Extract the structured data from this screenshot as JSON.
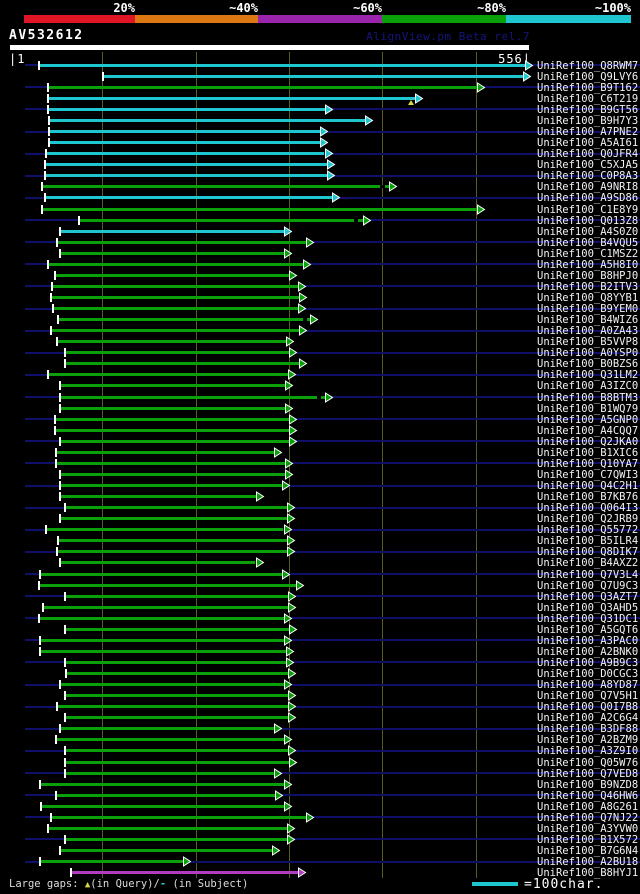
{
  "title": {
    "query_id": "AV532612",
    "watermark": "AlignView.pm Beta rel.7"
  },
  "ruler": {
    "start": "|1",
    "end": "556|"
  },
  "colors": {
    "red": "#de1626",
    "orange": "#dd7712",
    "purple": "#9b24ad",
    "green": "#0aa00a",
    "cyan": "#1ec7cf",
    "magenta": "#b13cc1",
    "navy": "#10106a",
    "grid": "#5c5c22",
    "white": "#ffffff",
    "watermark_text": "#15157d",
    "legend_text": "#dcdcdc",
    "gap_yellow": "#d6d64a"
  },
  "legend": {
    "large_gaps_prefix": "Large gaps: ",
    "query_gap_glyph": "▲",
    "query_gap_text": "(in Query)/",
    "subject_gap_glyph": "-",
    "subject_gap_text": " (in Subject)",
    "scale_bar_text": "=100char."
  },
  "chart_data": {
    "type": "bar",
    "orientation": "horizontal",
    "title": "AV532612 — graphical overview of database hits",
    "query_id": "AV532612",
    "query_length": 556,
    "x_axis": {
      "min": 1,
      "max": 556,
      "ticks": [
        100,
        200,
        300,
        400,
        500
      ]
    },
    "identity_scale": [
      {
        "label": "20%",
        "color_key": "red"
      },
      {
        "label": "~40%",
        "color_key": "orange"
      },
      {
        "label": "~60%",
        "color_key": "purple"
      },
      {
        "label": "~80%",
        "color_key": "green"
      },
      {
        "label": "~100%",
        "color_key": "cyan"
      }
    ],
    "hits": [
      {
        "id": "UniRef100_Q8RWM7",
        "color": "cyan",
        "q_start": 32,
        "q_end": 553
      },
      {
        "id": "UniRef100_Q9LVY6",
        "color": "cyan",
        "q_start": 101,
        "q_end": 551
      },
      {
        "id": "UniRef100_B9T162",
        "color": "green",
        "q_start": 42,
        "q_end": 501
      },
      {
        "id": "UniRef100_C6T219",
        "color": "cyan",
        "q_start": 42,
        "q_end": 435,
        "gap_query": 431
      },
      {
        "id": "UniRef100_B9GT56",
        "color": "cyan",
        "q_start": 42,
        "q_end": 338
      },
      {
        "id": "UniRef100_B9H7Y3",
        "color": "cyan",
        "q_start": 43,
        "q_end": 381
      },
      {
        "id": "UniRef100_A7PNE2",
        "color": "cyan",
        "q_start": 43,
        "q_end": 333
      },
      {
        "id": "UniRef100_A5AI61",
        "color": "cyan",
        "q_start": 43,
        "q_end": 333
      },
      {
        "id": "UniRef100_Q0JFR4",
        "color": "cyan",
        "q_start": 40,
        "q_end": 338
      },
      {
        "id": "UniRef100_C5XJA5",
        "color": "cyan",
        "q_start": 38,
        "q_end": 341
      },
      {
        "id": "UniRef100_C0P8A3",
        "color": "cyan",
        "q_start": 38,
        "q_end": 341
      },
      {
        "id": "UniRef100_A9NRI8",
        "color": "green",
        "q_start": 35,
        "q_end": 407,
        "gap_subject": 398
      },
      {
        "id": "UniRef100_A9SD86",
        "color": "cyan",
        "q_start": 38,
        "q_end": 346
      },
      {
        "id": "UniRef100_C1E8Y9",
        "color": "green",
        "q_start": 35,
        "q_end": 501
      },
      {
        "id": "UniRef100_Q013Z8",
        "color": "green",
        "q_start": 75,
        "q_end": 379,
        "gap_subject": 370
      },
      {
        "id": "UniRef100_A4S0Z0",
        "color": "cyan",
        "q_start": 55,
        "q_end": 295
      },
      {
        "id": "UniRef100_B4VQU5",
        "color": "green",
        "q_start": 51,
        "q_end": 318
      },
      {
        "id": "UniRef100_C1MSZ2",
        "color": "green",
        "q_start": 55,
        "q_end": 295
      },
      {
        "id": "UniRef100_A5H8I0",
        "color": "green",
        "q_start": 42,
        "q_end": 315
      },
      {
        "id": "UniRef100_B8HPJ0",
        "color": "green",
        "q_start": 49,
        "q_end": 300
      },
      {
        "id": "UniRef100_B2ITV3",
        "color": "green",
        "q_start": 46,
        "q_end": 310
      },
      {
        "id": "UniRef100_Q8YYB1",
        "color": "green",
        "q_start": 45,
        "q_end": 311
      },
      {
        "id": "UniRef100_B9YEM0",
        "color": "green",
        "q_start": 47,
        "q_end": 310
      },
      {
        "id": "UniRef100_B4WIZ6",
        "color": "green",
        "q_start": 52,
        "q_end": 322,
        "gap_subject": 315
      },
      {
        "id": "UniRef100_A0ZA43",
        "color": "green",
        "q_start": 45,
        "q_end": 311
      },
      {
        "id": "UniRef100_B5VVP8",
        "color": "green",
        "q_start": 51,
        "q_end": 297
      },
      {
        "id": "UniRef100_A0YSP0",
        "color": "green",
        "q_start": 60,
        "q_end": 300
      },
      {
        "id": "UniRef100_B0BZS6",
        "color": "green",
        "q_start": 60,
        "q_end": 311
      },
      {
        "id": "UniRef100_Q31LM2",
        "color": "green",
        "q_start": 42,
        "q_end": 299
      },
      {
        "id": "UniRef100_A3IZC0",
        "color": "green",
        "q_start": 54,
        "q_end": 296
      },
      {
        "id": "UniRef100_B8BTM3",
        "color": "green",
        "q_start": 54,
        "q_end": 338,
        "gap_subject": 330
      },
      {
        "id": "UniRef100_B1WQ79",
        "color": "green",
        "q_start": 54,
        "q_end": 296
      },
      {
        "id": "UniRef100_A5GNP0",
        "color": "green",
        "q_start": 49,
        "q_end": 300
      },
      {
        "id": "UniRef100_A4CQQ7",
        "color": "green",
        "q_start": 49,
        "q_end": 300
      },
      {
        "id": "UniRef100_Q2JKA0",
        "color": "green",
        "q_start": 54,
        "q_end": 300
      },
      {
        "id": "UniRef100_B1XIC6",
        "color": "green",
        "q_start": 50,
        "q_end": 284
      },
      {
        "id": "UniRef100_Q10YA7",
        "color": "green",
        "q_start": 50,
        "q_end": 296
      },
      {
        "id": "UniRef100_C7QWI3",
        "color": "green",
        "q_start": 54,
        "q_end": 296
      },
      {
        "id": "UniRef100_Q4C2H1",
        "color": "green",
        "q_start": 54,
        "q_end": 292
      },
      {
        "id": "UniRef100_B7KB76",
        "color": "green",
        "q_start": 54,
        "q_end": 264
      },
      {
        "id": "UniRef100_Q064I3",
        "color": "green",
        "q_start": 60,
        "q_end": 298
      },
      {
        "id": "UniRef100_Q2JRB9",
        "color": "green",
        "q_start": 55,
        "q_end": 298
      },
      {
        "id": "UniRef100_Q55772",
        "color": "green",
        "q_start": 40,
        "q_end": 294
      },
      {
        "id": "UniRef100_B5ILR4",
        "color": "green",
        "q_start": 52,
        "q_end": 298
      },
      {
        "id": "UniRef100_Q8DIK7",
        "color": "green",
        "q_start": 51,
        "q_end": 298
      },
      {
        "id": "UniRef100_B4AXZ2",
        "color": "green",
        "q_start": 55,
        "q_end": 264
      },
      {
        "id": "UniRef100_Q7V3L4",
        "color": "green",
        "q_start": 33,
        "q_end": 292
      },
      {
        "id": "UniRef100_Q7U9C3",
        "color": "green",
        "q_start": 32,
        "q_end": 307
      },
      {
        "id": "UniRef100_Q3AZT7",
        "color": "green",
        "q_start": 60,
        "q_end": 299
      },
      {
        "id": "UniRef100_Q3AHD5",
        "color": "green",
        "q_start": 36,
        "q_end": 299
      },
      {
        "id": "UniRef100_Q31DC1",
        "color": "green",
        "q_start": 32,
        "q_end": 295
      },
      {
        "id": "UniRef100_A5GQT6",
        "color": "green",
        "q_start": 60,
        "q_end": 300
      },
      {
        "id": "UniRef100_A3PAC0",
        "color": "green",
        "q_start": 33,
        "q_end": 295
      },
      {
        "id": "UniRef100_A2BNK0",
        "color": "green",
        "q_start": 33,
        "q_end": 297
      },
      {
        "id": "UniRef100_A9B9C3",
        "color": "green",
        "q_start": 60,
        "q_end": 297
      },
      {
        "id": "UniRef100_D0CGC3",
        "color": "green",
        "q_start": 61,
        "q_end": 299
      },
      {
        "id": "UniRef100_A8YD87",
        "color": "green",
        "q_start": 54,
        "q_end": 295
      },
      {
        "id": "UniRef100_Q7V5H1",
        "color": "green",
        "q_start": 60,
        "q_end": 299
      },
      {
        "id": "UniRef100_Q0I7B8",
        "color": "green",
        "q_start": 51,
        "q_end": 299
      },
      {
        "id": "UniRef100_A2C6G4",
        "color": "green",
        "q_start": 60,
        "q_end": 299
      },
      {
        "id": "UniRef100_B3DF88",
        "color": "green",
        "q_start": 54,
        "q_end": 284
      },
      {
        "id": "UniRef100_A2BZM9",
        "color": "green",
        "q_start": 50,
        "q_end": 295
      },
      {
        "id": "UniRef100_A3Z9I0",
        "color": "green",
        "q_start": 60,
        "q_end": 299
      },
      {
        "id": "UniRef100_Q05W76",
        "color": "green",
        "q_start": 60,
        "q_end": 300
      },
      {
        "id": "UniRef100_Q7VED8",
        "color": "green",
        "q_start": 60,
        "q_end": 284
      },
      {
        "id": "UniRef100_B9NZD8",
        "color": "green",
        "q_start": 33,
        "q_end": 295
      },
      {
        "id": "UniRef100_Q46HW6",
        "color": "green",
        "q_start": 50,
        "q_end": 285
      },
      {
        "id": "UniRef100_A8G261",
        "color": "green",
        "q_start": 34,
        "q_end": 295
      },
      {
        "id": "UniRef100_Q7NJ22",
        "color": "green",
        "q_start": 45,
        "q_end": 318
      },
      {
        "id": "UniRef100_A3YVW0",
        "color": "green",
        "q_start": 42,
        "q_end": 298
      },
      {
        "id": "UniRef100_B1X572",
        "color": "green",
        "q_start": 60,
        "q_end": 298
      },
      {
        "id": "UniRef100_B7G6N4",
        "color": "green",
        "q_start": 54,
        "q_end": 282
      },
      {
        "id": "UniRef100_A2BU18",
        "color": "green",
        "q_start": 33,
        "q_end": 186
      },
      {
        "id": "UniRef100_B8HYJ1",
        "color": "magenta",
        "q_start": 66,
        "q_end": 310
      }
    ]
  }
}
